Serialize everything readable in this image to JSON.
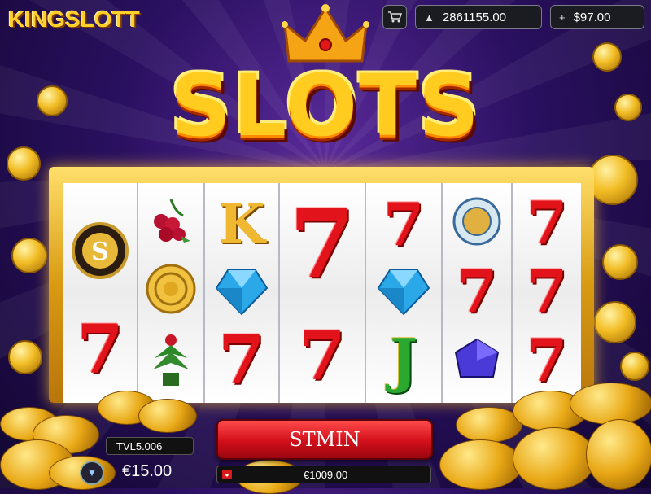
{
  "header": {
    "logo": "KINGSLOTT",
    "cart_icon": "cart-icon",
    "balance_primary": {
      "icon": "coins-icon",
      "value": "2861155.00"
    },
    "balance_secondary": {
      "icon": "plus-icon",
      "value": "$97.00"
    }
  },
  "game": {
    "title": "SLOTS",
    "reels": [
      [
        "emblem-s",
        "cherries",
        "seven"
      ],
      [
        "cherries",
        "gold-coin",
        "plant"
      ],
      [
        "letter-k",
        "diamond-blue",
        "seven"
      ],
      [
        "seven-big",
        "seven"
      ],
      [
        "seven",
        "diamond-blue",
        "letter-j"
      ],
      [
        "badge-emblem",
        "seven",
        "gem-purple"
      ],
      [
        "seven",
        "seven",
        "seven"
      ]
    ]
  },
  "controls": {
    "spin_label": "STMIN",
    "win_label": "TVL5.006",
    "bet_icon": "chevron-down-icon",
    "bet_value": "€15.00",
    "total_value": "€1009.00"
  },
  "colors": {
    "background": "#2a1060",
    "title": "#ffcc1f",
    "frame": "#d89a12",
    "seven": "#e3131b",
    "spin_button": "#d10f1a"
  }
}
